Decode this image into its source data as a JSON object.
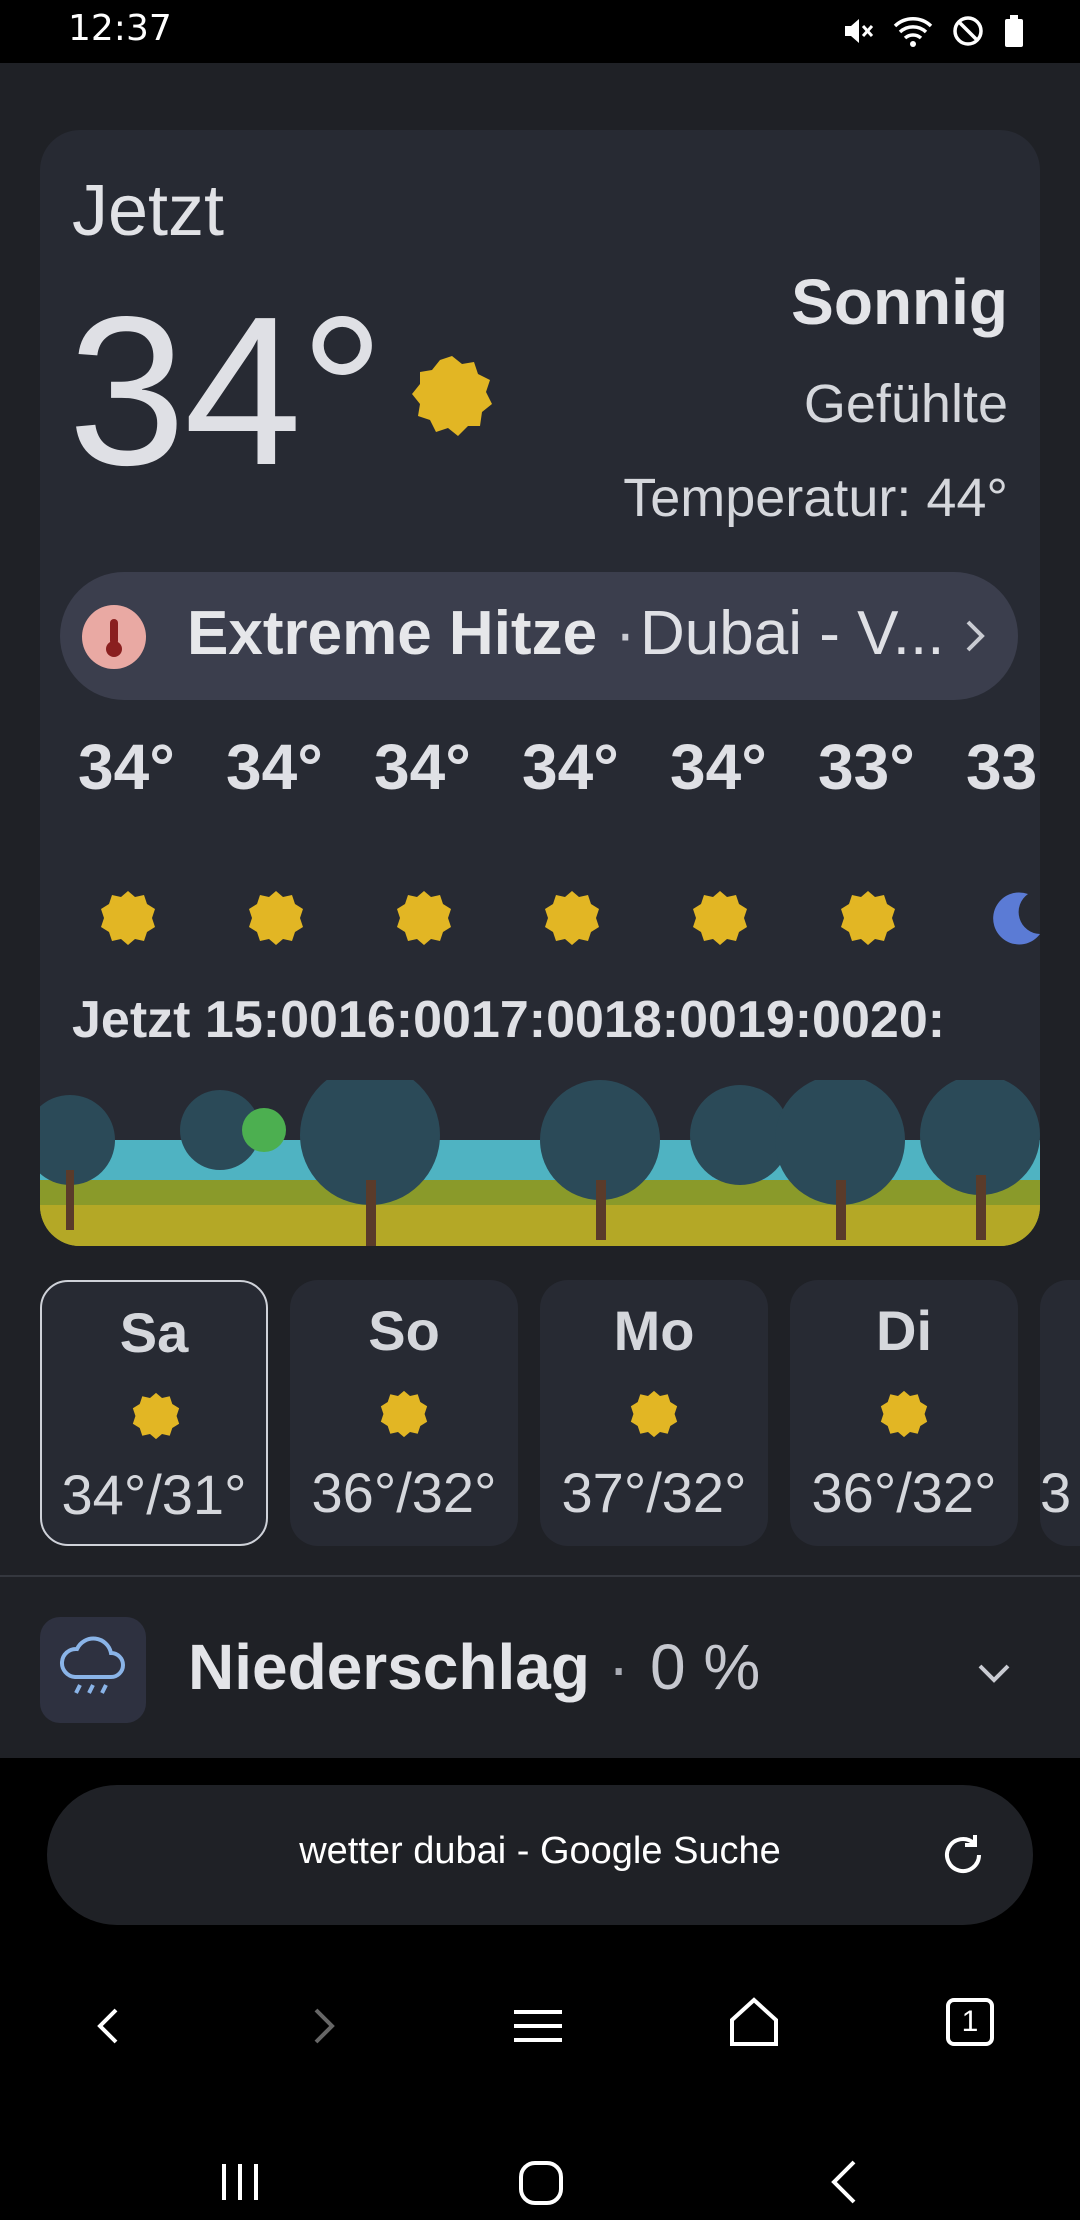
{
  "status": {
    "time": "12:37"
  },
  "weather": {
    "now_label": "Jetzt",
    "temperature": "34°",
    "condition": "Sonnig",
    "feels_line1": "Gefühlte",
    "feels_line2": "Temperatur: 44°",
    "alert": {
      "title": "Extreme Hitze",
      "separator": "·",
      "location": "Dubai - V..."
    },
    "hourly": [
      {
        "temp": "34°",
        "icon": "sun-icon"
      },
      {
        "temp": "34°",
        "icon": "sun-icon"
      },
      {
        "temp": "34°",
        "icon": "sun-icon"
      },
      {
        "temp": "34°",
        "icon": "sun-icon"
      },
      {
        "temp": "34°",
        "icon": "sun-icon"
      },
      {
        "temp": "33°",
        "icon": "sun-icon"
      },
      {
        "temp": "33",
        "icon": "moon-icon"
      }
    ],
    "hour_labels": "Jetzt 15:0016:0017:0018:0019:0020:",
    "days": [
      {
        "name": "Sa",
        "temps": "34°/31°",
        "icon": "sun-icon",
        "selected": true
      },
      {
        "name": "So",
        "temps": "36°/32°",
        "icon": "sun-icon"
      },
      {
        "name": "Mo",
        "temps": "37°/32°",
        "icon": "sun-icon"
      },
      {
        "name": "Di",
        "temps": "36°/32°",
        "icon": "sun-icon"
      },
      {
        "name": "",
        "temps": "3",
        "icon": "sun-icon"
      }
    ],
    "precipitation": {
      "label": "Niederschlag",
      "dot": "·",
      "value": "0 %"
    }
  },
  "browser": {
    "url_text": "wetter dubai - Google Suche",
    "tab_count": "1"
  },
  "colors": {
    "sun": "#e2b624",
    "moon": "#5b7bd5",
    "card": "#272a33",
    "alert": "#3b3e4d"
  }
}
